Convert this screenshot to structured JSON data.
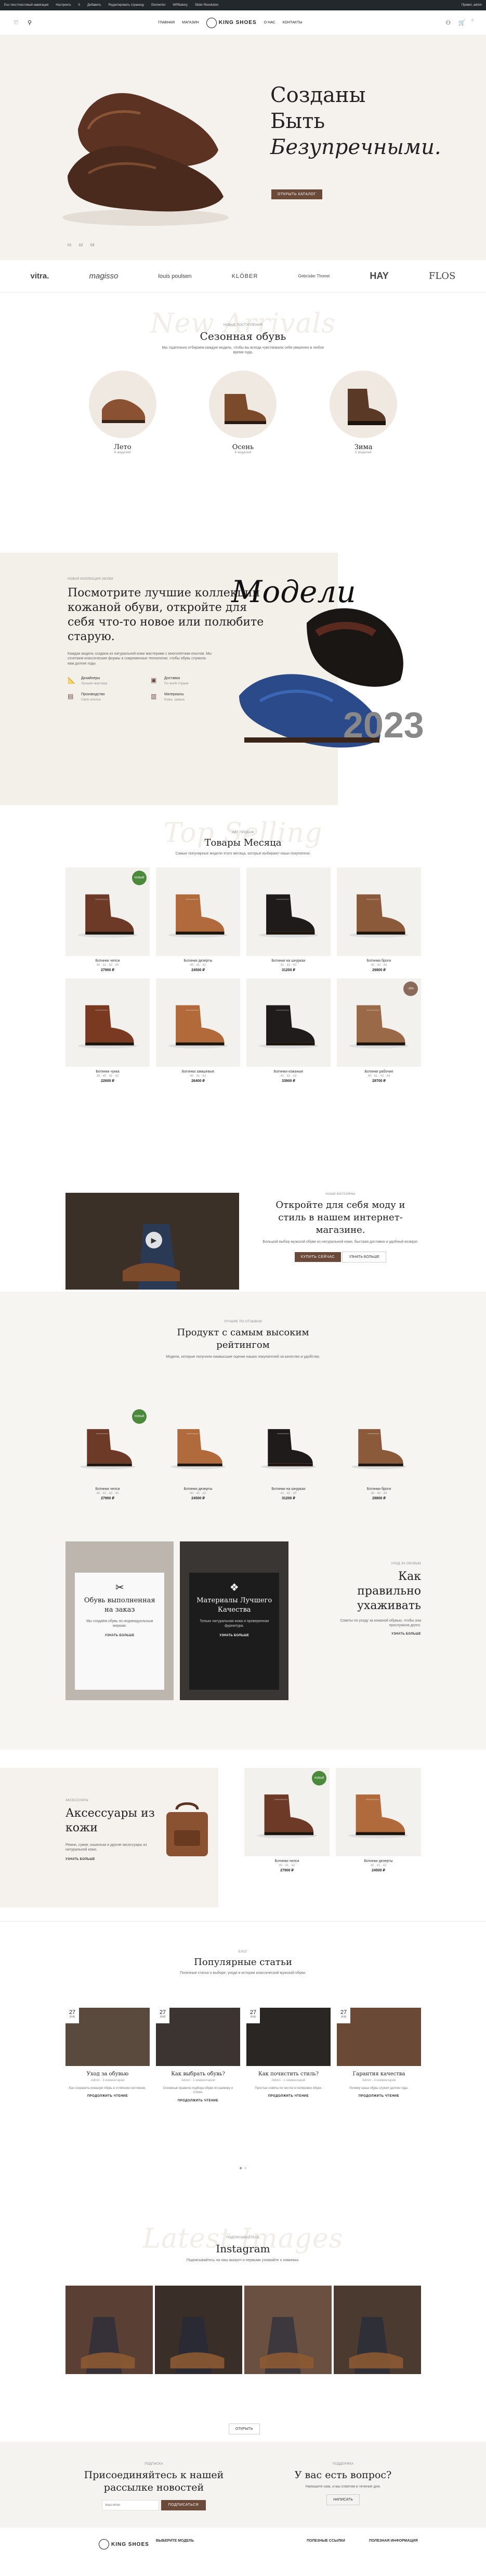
{
  "adminbar": {
    "items": [
      "Esc-тексттекстовый навигация",
      "Настроить",
      "0",
      "Добавить",
      "Редактировать страницу",
      "Elementor",
      "WPBakery",
      "Slider Revolution"
    ],
    "greeting": "Привет, admin"
  },
  "header": {
    "logo": "KING SHOES",
    "nav": [
      "ГЛАВНАЯ",
      "МАГАЗИН",
      "О НАС",
      "КОНТАКТЫ"
    ],
    "cart_count": "0"
  },
  "hero": {
    "title_line1": "Созданы",
    "title_line2": "Быть",
    "title_line3": "Безупречными.",
    "button": "ОТКРЫТЬ КАТАЛОГ",
    "slides": [
      "01",
      "02",
      "03"
    ]
  },
  "brands": [
    "vitra.",
    "magisso",
    "louis poulsen",
    "KLÖBER",
    "Gebrüder Thonet",
    "HAY",
    "FLOS"
  ],
  "season": {
    "ghost": "New Arrivals",
    "eyebrow": "НОВЫЕ ПОСТУПЛЕНИЯ",
    "title": "Сезонная обувь",
    "subtitle": "Мы тщательно отбираем каждую модель, чтобы вы всегда чувствовали себя уверенно в любое время года.",
    "categories": [
      {
        "name": "Лето",
        "count": "6 моделей"
      },
      {
        "name": "Осень",
        "count": "8 моделей"
      },
      {
        "name": "Зима",
        "count": "5 моделей"
      }
    ]
  },
  "promo": {
    "eyebrow": "НОВАЯ КОЛЛЕКЦИЯ ОБУВИ",
    "title": "Посмотрите лучшие коллекции кожаной обуви, откройте для себя что-то новое или полюбите старую.",
    "text": "Каждая модель создана из натуральной кожи мастерами с многолетним опытом. Мы сочетаем классические формы и современные технологии, чтобы обувь служила вам долгие годы.",
    "features": [
      {
        "icon": "ruler-icon",
        "title": "Дизайнеры",
        "text": "Лучшие мастера"
      },
      {
        "icon": "box-icon",
        "title": "Доставка",
        "text": "По всей стране"
      },
      {
        "icon": "cash-icon",
        "title": "Производство",
        "text": "Своё ателье"
      },
      {
        "icon": "shirt-icon",
        "title": "Материалы",
        "text": "Кожа, замша"
      }
    ],
    "model_label": "Модели",
    "model_year": "2023"
  },
  "products": {
    "ghost": "Top Selling",
    "eyebrow": "ХИТ ПРОДАЖ",
    "title": "Товары Месяца",
    "subtitle": "Самые популярные модели этого месяца, которые выбирают наши покупатели.",
    "items": [
      {
        "name": "Ботинки челси",
        "meta": "40 · 41 · 42 · 43",
        "price": "27900 ₽",
        "badge": "НОВЫЙ",
        "color": "#6e3a28"
      },
      {
        "name": "Ботинки дезерты",
        "meta": "40 · 41 · 42",
        "price": "24500 ₽",
        "badge": "",
        "color": "#b06a3c"
      },
      {
        "name": "Ботинки на шнурках",
        "meta": "41 · 42 · 43",
        "price": "31200 ₽",
        "badge": "",
        "color": "#1e1b1a"
      },
      {
        "name": "Ботинки броги",
        "meta": "40 · 42 · 44",
        "price": "29800 ₽",
        "badge": "",
        "color": "#8a5a3a"
      },
      {
        "name": "Ботинки чукка",
        "meta": "39 · 40 · 41 · 42",
        "price": "22600 ₽",
        "badge": "",
        "color": "#7a3a22"
      },
      {
        "name": "Ботинки замшевые",
        "meta": "40 · 41 · 42",
        "price": "26400 ₽",
        "badge": "",
        "color": "#b26a3a"
      },
      {
        "name": "Ботинки кожаные",
        "meta": "41 · 42 · 43",
        "price": "33900 ₽",
        "badge": "",
        "color": "#1f1c1b"
      },
      {
        "name": "Ботинки рабочие",
        "meta": "40 · 41 · 42 · 43",
        "price": "28700 ₽",
        "badge": "-15%",
        "color": "#9a6a48"
      }
    ]
  },
  "video": {
    "eyebrow": "НАШИ МАГАЗИНЫ",
    "title": "Откройте для себя моду и стиль в нашем интернет-магазине.",
    "text": "Большой выбор мужской обуви из натуральной кожи, быстрая доставка и удобный возврат.",
    "btn_primary": "КУПИТЬ СЕЙЧАС",
    "btn_secondary": "УЗНАТЬ БОЛЬШЕ"
  },
  "toprated": {
    "eyebrow": "ЛУЧШИЕ ПО ОТЗЫВАМ",
    "title": "Продукт с самым высоким рейтингом",
    "subtitle": "Модели, которые получили наивысшие оценки наших покупателей за качество и удобство.",
    "items": [
      {
        "name": "Ботинки челси",
        "meta": "40 · 41 · 42 · 43",
        "price": "27900 ₽",
        "badge": "НОВЫЙ",
        "color": "#6e3a28"
      },
      {
        "name": "Ботинки дезерты",
        "meta": "40 · 41 · 42",
        "price": "24500 ₽",
        "badge": "",
        "color": "#b06a3c"
      },
      {
        "name": "Ботинки на шнурках",
        "meta": "41 · 42 · 43",
        "price": "31200 ₽",
        "badge": "",
        "color": "#1e1b1a"
      },
      {
        "name": "Ботинки броги",
        "meta": "40 · 42 · 44",
        "price": "29800 ₽",
        "badge": "",
        "color": "#8a5a3a"
      }
    ],
    "tiles": [
      {
        "title": "Обувь выполненная на заказ",
        "text": "Мы создаём обувь по индивидуальным меркам.",
        "link": "УЗНАТЬ БОЛЬШЕ"
      },
      {
        "title": "Материалы Лучшего Качества",
        "text": "Только натуральная кожа и проверенная фурнитура.",
        "link": "УЗНАТЬ БОЛЬШЕ"
      }
    ],
    "care_eyebrow": "УХОД ЗА ОБУВЬЮ",
    "care_title": "Как правильно ухаживать",
    "care_text": "Советы по уходу за кожаной обувью, чтобы она прослужила долго.",
    "care_link": "УЗНАТЬ БОЛЬШЕ"
  },
  "access": {
    "eyebrow": "АКСЕССУАРЫ",
    "title": "Аксессуары из кожи",
    "text": "Ремни, сумки, кошельки и другие аксессуары из натуральной кожи.",
    "link": "УЗНАТЬ БОЛЬШЕ",
    "items": [
      {
        "name": "Ботинки челси",
        "meta": "40 · 41 · 42",
        "price": "27900 ₽",
        "badge": "НОВЫЙ",
        "color": "#6e3a28"
      },
      {
        "name": "Ботинки дезерты",
        "meta": "40 · 41 · 42",
        "price": "24500 ₽",
        "badge": "",
        "color": "#b06a3c"
      }
    ]
  },
  "articles": {
    "eyebrow": "БЛОГ",
    "title": "Популярные статьи",
    "subtitle": "Полезные статьи о выборе, уходе и истории классической мужской обуви.",
    "items": [
      {
        "day": "27",
        "month": "ЯНВ",
        "title": "Уход за обувью",
        "meta": "Admin · 3 комментария",
        "excerpt": "Как сохранить кожаную обувь в отличном состоянии.",
        "more": "ПРОДОЛЖИТЬ ЧТЕНИЕ",
        "color": "#5a4a3e"
      },
      {
        "day": "27",
        "month": "ЯНВ",
        "title": "Как выбрать обувь?",
        "meta": "Admin · 2 комментария",
        "excerpt": "Основные правила подбора обуви по размеру и стилю.",
        "more": "ПРОДОЛЖИТЬ ЧТЕНИЕ",
        "color": "#3c3430"
      },
      {
        "day": "27",
        "month": "ЯНВ",
        "title": "Как почистить стиль?",
        "meta": "Admin · 1 комментарий",
        "excerpt": "Простые советы по чистке и полировке обуви.",
        "more": "ПРОДОЛЖИТЬ ЧТЕНИЕ",
        "color": "#2a2624"
      },
      {
        "day": "27",
        "month": "ЯНВ",
        "title": "Гарантия качества",
        "meta": "Admin · 4 комментария",
        "excerpt": "Почему наша обувь служит долгие годы.",
        "more": "ПРОДОЛЖИТЬ ЧТЕНИЕ",
        "color": "#6a4a36"
      }
    ],
    "pager": "● ○"
  },
  "insta": {
    "ghost": "Latest Images",
    "eyebrow": "ПОДПИСЫВАЙТЕСЬ",
    "title": "Instagram",
    "subtitle": "Подписывайтесь на наш аккаунт и первыми узнавайте о новинках.",
    "button": "ОТКРЫТЬ",
    "colors": [
      "#5a4034",
      "#3a2e28",
      "#6a5040",
      "#4a3a30"
    ]
  },
  "newsletter": {
    "eyebrow": "ПОДПИСКА",
    "title": "Присоединяйтесь к нашей рассылке новостей",
    "placeholder": "Ваш email",
    "button": "ПОДПИСАТЬСЯ",
    "q_eyebrow": "ПОДДЕРЖКА",
    "q_title": "У вас есть вопрос?",
    "q_text": "Напишите нам, и мы ответим в течение дня.",
    "q_button": "НАПИСАТЬ"
  },
  "footer": {
    "logo": "KING SHOES",
    "col1": "ВЫБЕРИТЕ МОДЕЛЬ",
    "col2": "ПОЛЕЗНЫЕ ССЫЛКИ",
    "col3": "ПОЛЕЗНАЯ ИНФОРМАЦИЯ"
  },
  "colors": {
    "accent": "#6b4a3a",
    "badge_new": "#4a8a3a",
    "badge_sale": "#8a6a5a"
  }
}
